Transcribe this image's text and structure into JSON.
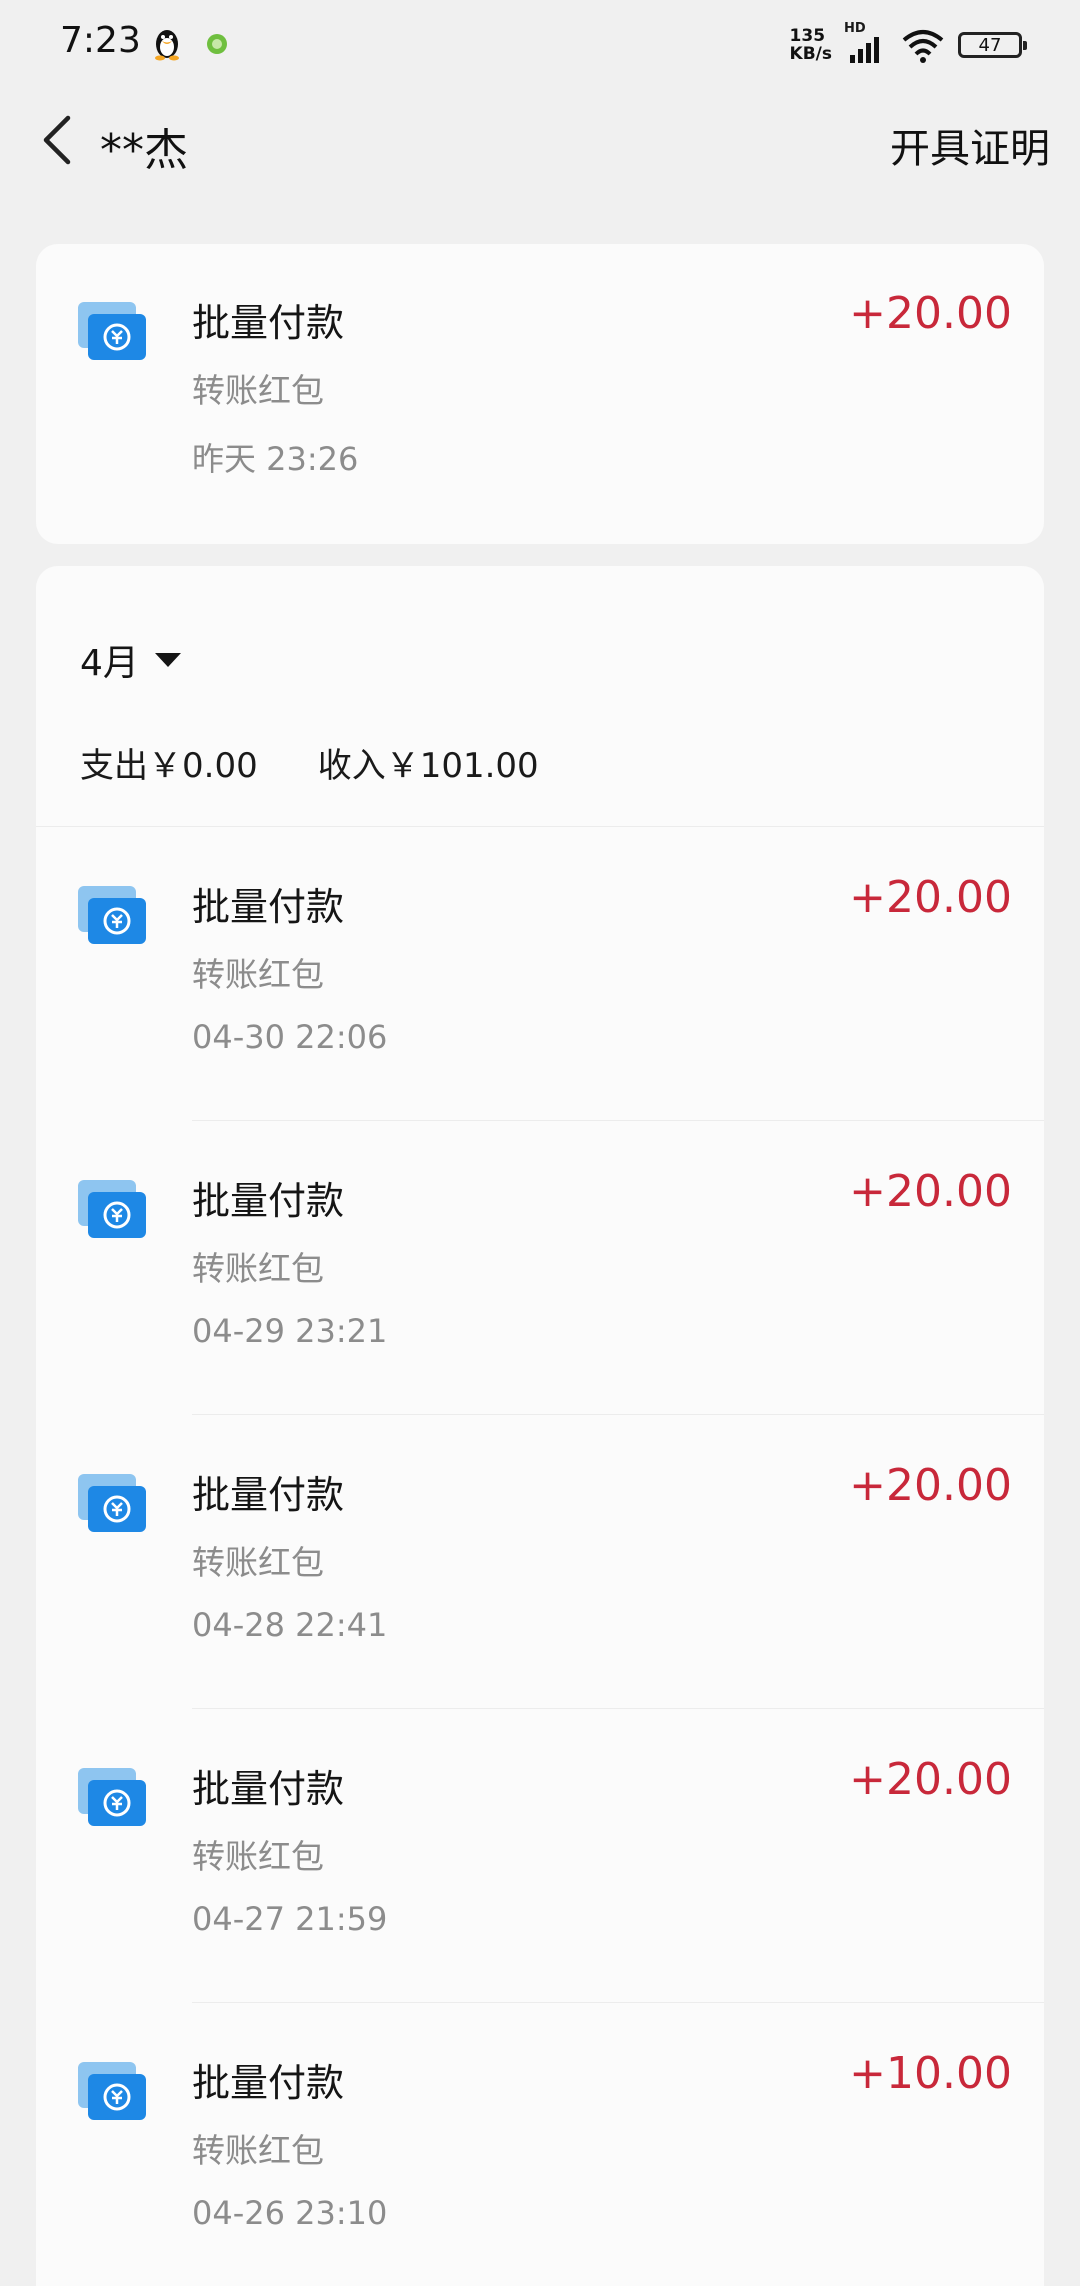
{
  "status_bar": {
    "time": "7:23",
    "net_speed_value": "135",
    "net_speed_unit": "KB/s",
    "network_label": "HD",
    "battery": "47"
  },
  "header": {
    "title": "**杰",
    "action_label": "开具证明"
  },
  "top_transaction": {
    "title": "批量付款",
    "subtitle": "转账红包",
    "time": "昨天 23:26",
    "amount": "+20.00"
  },
  "month_section": {
    "month_label": "4月",
    "expense_label": "支出",
    "expense_value": "￥0.00",
    "income_label": "收入",
    "income_value": "￥101.00"
  },
  "transactions": [
    {
      "title": "批量付款",
      "subtitle": "转账红包",
      "time": "04-30 22:06",
      "amount": "+20.00"
    },
    {
      "title": "批量付款",
      "subtitle": "转账红包",
      "time": "04-29 23:21",
      "amount": "+20.00"
    },
    {
      "title": "批量付款",
      "subtitle": "转账红包",
      "time": "04-28 22:41",
      "amount": "+20.00"
    },
    {
      "title": "批量付款",
      "subtitle": "转账红包",
      "time": "04-27 21:59",
      "amount": "+20.00"
    },
    {
      "title": "批量付款",
      "subtitle": "转账红包",
      "time": "04-26 23:10",
      "amount": "+10.00"
    }
  ],
  "colors": {
    "amount_positive": "#c8283a",
    "icon_blue": "#1e88e5",
    "icon_light_blue": "#8ec5f0"
  },
  "icons": {
    "back": "chevron-left-icon",
    "transfer": "transfer-payment-icon",
    "month_dropdown": "triangle-down-icon"
  }
}
